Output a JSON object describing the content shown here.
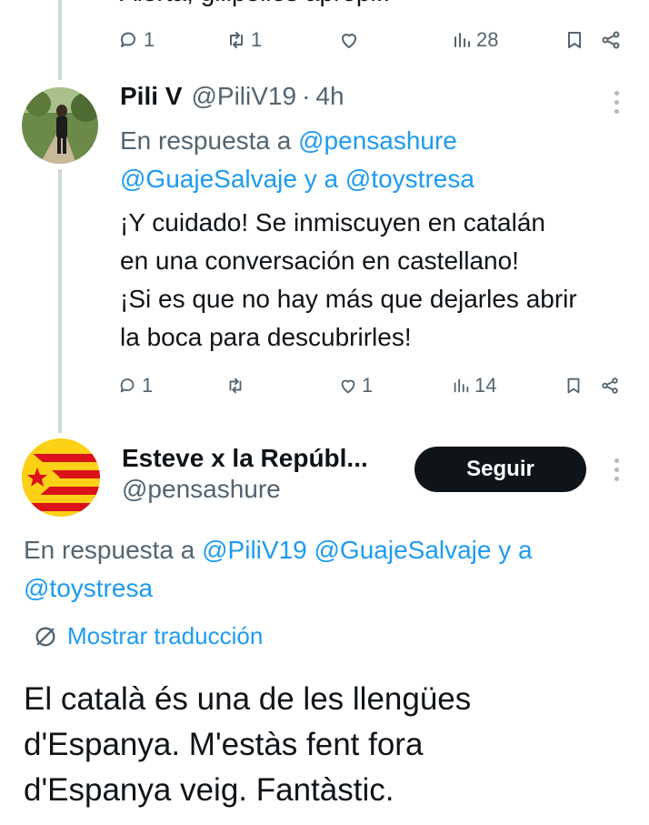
{
  "top_tweet": {
    "text_fragment": "Alerta, gilipolles apropi!!",
    "actions": {
      "replies": "1",
      "retweets": "1",
      "likes": "",
      "views": "28"
    }
  },
  "reply_tweet": {
    "display_name": "Pili V",
    "handle": "@PiliV19",
    "separator": "·",
    "time": "4h",
    "reply_prefix": "En respuesta a",
    "reply_mention_1": "@pensashure",
    "reply_mention_2": "@GuajeSalvaje",
    "reply_and": "y a",
    "reply_mention_3": "@toystresa",
    "text_lines": [
      "¡Y cuidado! Se inmiscuyen en catalán",
      "en una conversación en castellano!",
      "¡Si es que no hay más que dejarles abrir",
      "la boca para descubrirles!"
    ],
    "actions": {
      "replies": "1",
      "retweets": "",
      "likes": "1",
      "views": "14"
    }
  },
  "main_tweet": {
    "display_name": "Esteve x la Repúbl...",
    "handle": "@pensashure",
    "follow_label": "Seguir",
    "reply_prefix": "En respuesta a",
    "reply_mention_1": "@PiliV19",
    "reply_mention_2": "@GuajeSalvaje",
    "reply_and": "y a",
    "reply_mention_3": "@toystresa",
    "translate_label": "Mostrar traducción",
    "text_lines": [
      "El català és una de les llengües",
      "d'Espanya. M'estàs fent fora",
      "d'Espanya veig. Fantàstic."
    ]
  },
  "colors": {
    "link": "#1d9bf0",
    "secondary_text": "#536471",
    "primary_text": "#0f1419",
    "thread_line": "#cfd9de",
    "flag_yellow": "#fcd116",
    "flag_red": "#da121a"
  }
}
